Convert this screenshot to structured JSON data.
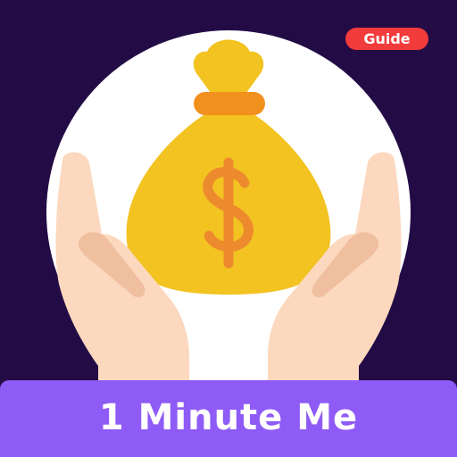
{
  "badge": {
    "label": "Guide"
  },
  "banner": {
    "title": "1 Minute Me"
  },
  "artwork": {
    "currency_symbol": "$",
    "icons": [
      "money-bag-icon",
      "dollar-sign-icon",
      "left-hand-icon",
      "right-hand-icon"
    ]
  },
  "colors": {
    "background": "#230C45",
    "circle": "#FFFFFF",
    "bag": "#F2C321",
    "bag_tie": "#F2901E",
    "dollar": "#EE8A2E",
    "hand_skin": "#FCD8BE",
    "hand_shadow": "#F0BFA0",
    "banner": "#8F5BF6",
    "badge": "#F23B3B",
    "text": "#FFFFFF"
  }
}
